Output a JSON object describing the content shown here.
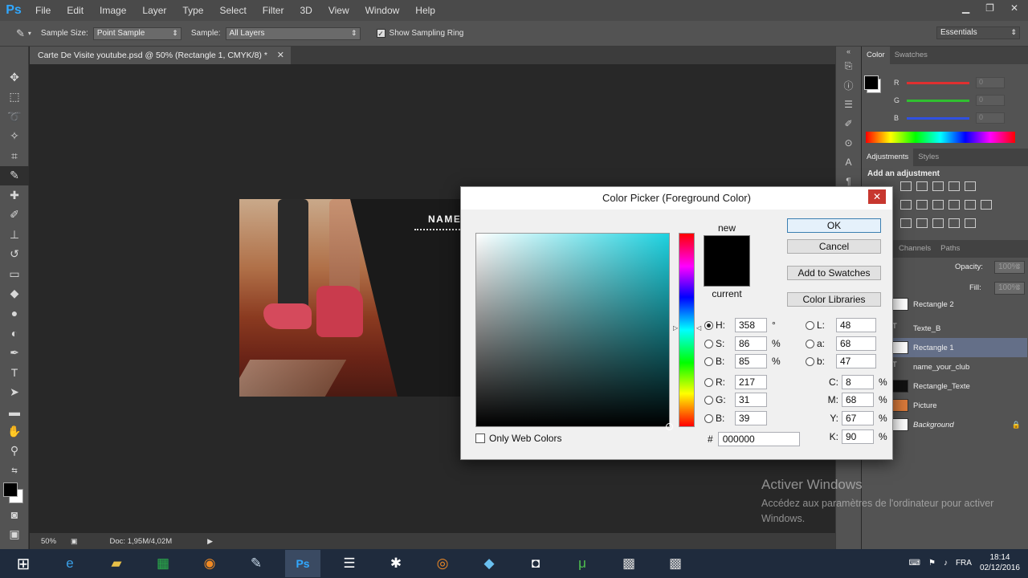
{
  "app": {
    "logo": "Ps"
  },
  "menu": [
    "File",
    "Edit",
    "Image",
    "Layer",
    "Type",
    "Select",
    "Filter",
    "3D",
    "View",
    "Window",
    "Help"
  ],
  "options_bar": {
    "sample_size_label": "Sample Size:",
    "sample_size_value": "Point Sample",
    "sample_label": "Sample:",
    "sample_value": "All Layers",
    "show_ring_label": "Show Sampling Ring",
    "show_ring_checked": true,
    "workspace": "Essentials"
  },
  "document": {
    "tab_title": "Carte De Visite youtube.psd @ 50% (Rectangle 1, CMYK/8) *",
    "name_text": "NAME",
    "zoom": "50%",
    "doc_size": "Doc: 1,95M/4,02M"
  },
  "color_panel": {
    "tabs": [
      "Color",
      "Swatches"
    ],
    "rows": [
      {
        "label": "R",
        "value": "0",
        "color": "#e03030"
      },
      {
        "label": "G",
        "value": "0",
        "color": "#30c030"
      },
      {
        "label": "B",
        "value": "0",
        "color": "#3050e0"
      }
    ]
  },
  "adjustments_panel": {
    "tabs": [
      "Adjustments",
      "Styles"
    ],
    "heading": "Add an adjustment"
  },
  "layers_panel": {
    "tabs": [
      "Channels",
      "Paths"
    ],
    "opacity_label": "Opacity:",
    "opacity_value": "100%",
    "fill_label": "Fill:",
    "fill_value": "100%",
    "layers": [
      {
        "name": "Rectangle 2",
        "kind": "shape"
      },
      {
        "name": "Texte_B",
        "kind": "text"
      },
      {
        "name": "Rectangle 1",
        "kind": "shape",
        "selected": true
      },
      {
        "name": "name_your_club",
        "kind": "text"
      },
      {
        "name": "Rectangle_Texte",
        "kind": "shape"
      },
      {
        "name": "Picture",
        "kind": "image"
      },
      {
        "name": "Background",
        "kind": "background",
        "locked": true
      }
    ]
  },
  "dialog": {
    "title": "Color Picker (Foreground Color)",
    "new_label": "new",
    "current_label": "current",
    "buttons": {
      "ok": "OK",
      "cancel": "Cancel",
      "add_swatches": "Add to Swatches",
      "libraries": "Color Libraries"
    },
    "hsb": [
      {
        "label": "H:",
        "value": "358",
        "unit": "°",
        "selected": true
      },
      {
        "label": "S:",
        "value": "86",
        "unit": "%"
      },
      {
        "label": "B:",
        "value": "85",
        "unit": "%"
      }
    ],
    "rgb": [
      {
        "label": "R:",
        "value": "217"
      },
      {
        "label": "G:",
        "value": "31"
      },
      {
        "label": "B:",
        "value": "39"
      }
    ],
    "lab": [
      {
        "label": "L:",
        "value": "48"
      },
      {
        "label": "a:",
        "value": "68"
      },
      {
        "label": "b:",
        "value": "47"
      }
    ],
    "cmyk": [
      {
        "label": "C:",
        "value": "8",
        "unit": "%"
      },
      {
        "label": "M:",
        "value": "68",
        "unit": "%"
      },
      {
        "label": "Y:",
        "value": "67",
        "unit": "%"
      },
      {
        "label": "K:",
        "value": "90",
        "unit": "%"
      }
    ],
    "hex_label": "#",
    "hex_value": "000000",
    "web_colors_label": "Only Web Colors",
    "web_colors_checked": false,
    "new_color": "#000000"
  },
  "watermark": {
    "title": "Activer Windows",
    "subtitle": "Accédez aux paramètres de l'ordinateur pour activer Windows."
  },
  "taskbar": {
    "language": "FRA",
    "time": "18:14",
    "date": "02/12/2016"
  }
}
